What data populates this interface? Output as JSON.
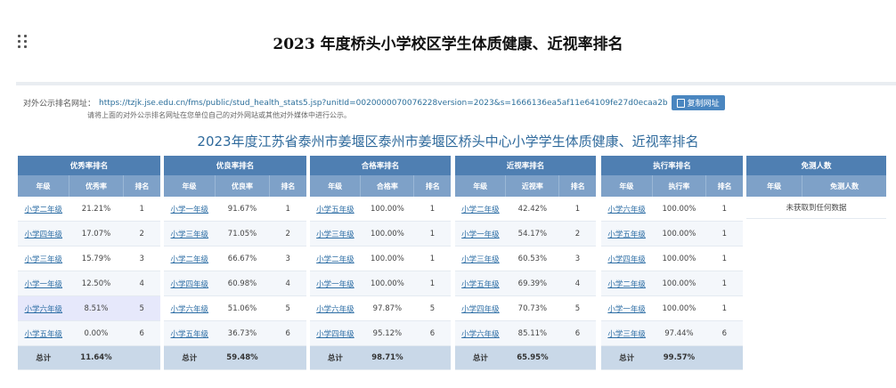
{
  "page_title": "2023 年度桥头小学校区学生体质健康、近视率排名",
  "url_row": {
    "label": "对外公示排名网址：",
    "url": "https://tzjk.jse.edu.cn/fms/public/stud_health_stats5.jsp?unitId=0020000070076228version=2023&s=1666136ea5af11e64109fe27d0ecaa2b",
    "copy_label": "复制网址"
  },
  "note": "请将上面的对外公示排名网址在您单位自己的对外网站或其他对外媒体中进行公示。",
  "report_title": "2023年度江苏省泰州市姜堰区泰州市姜堰区桥头中心小学学生体质健康、近视率排名",
  "colors": {
    "group_header": "#4f7fb2",
    "col_header": "#7ea1c8",
    "total_row": "#c9d8e8",
    "link": "#2d6ea5",
    "title": "#2f6a9c"
  },
  "tables": [
    {
      "title": "优秀率排名",
      "headers": [
        "年级",
        "优秀率",
        "排名"
      ],
      "rows": [
        [
          "小学二年级",
          "21.21%",
          "1"
        ],
        [
          "小学四年级",
          "17.07%",
          "2"
        ],
        [
          "小学三年级",
          "15.79%",
          "3"
        ],
        [
          "小学一年级",
          "12.50%",
          "4"
        ],
        [
          "小学六年级",
          "8.51%",
          "5"
        ],
        [
          "小学五年级",
          "0.00%",
          "6"
        ]
      ],
      "total": [
        "总计",
        "11.64%",
        ""
      ]
    },
    {
      "title": "优良率排名",
      "headers": [
        "年级",
        "优良率",
        "排名"
      ],
      "rows": [
        [
          "小学一年级",
          "91.67%",
          "1"
        ],
        [
          "小学三年级",
          "71.05%",
          "2"
        ],
        [
          "小学二年级",
          "66.67%",
          "3"
        ],
        [
          "小学四年级",
          "60.98%",
          "4"
        ],
        [
          "小学六年级",
          "51.06%",
          "5"
        ],
        [
          "小学五年级",
          "36.73%",
          "6"
        ]
      ],
      "total": [
        "总计",
        "59.48%",
        ""
      ]
    },
    {
      "title": "合格率排名",
      "headers": [
        "年级",
        "合格率",
        "排名"
      ],
      "rows": [
        [
          "小学五年级",
          "100.00%",
          "1"
        ],
        [
          "小学三年级",
          "100.00%",
          "1"
        ],
        [
          "小学二年级",
          "100.00%",
          "1"
        ],
        [
          "小学一年级",
          "100.00%",
          "1"
        ],
        [
          "小学六年级",
          "97.87%",
          "5"
        ],
        [
          "小学四年级",
          "95.12%",
          "6"
        ]
      ],
      "total": [
        "总计",
        "98.71%",
        ""
      ]
    },
    {
      "title": "近视率排名",
      "headers": [
        "年级",
        "近视率",
        "排名"
      ],
      "rows": [
        [
          "小学二年级",
          "42.42%",
          "1"
        ],
        [
          "小学一年级",
          "54.17%",
          "2"
        ],
        [
          "小学三年级",
          "60.53%",
          "3"
        ],
        [
          "小学五年级",
          "69.39%",
          "4"
        ],
        [
          "小学四年级",
          "70.73%",
          "5"
        ],
        [
          "小学六年级",
          "85.11%",
          "6"
        ]
      ],
      "total": [
        "总计",
        "65.95%",
        ""
      ]
    },
    {
      "title": "执行率排名",
      "headers": [
        "年级",
        "执行率",
        "排名"
      ],
      "rows": [
        [
          "小学六年级",
          "100.00%",
          "1"
        ],
        [
          "小学五年级",
          "100.00%",
          "1"
        ],
        [
          "小学四年级",
          "100.00%",
          "1"
        ],
        [
          "小学二年级",
          "100.00%",
          "1"
        ],
        [
          "小学一年级",
          "100.00%",
          "1"
        ],
        [
          "小学三年级",
          "97.44%",
          "6"
        ]
      ],
      "total": [
        "总计",
        "99.57%",
        ""
      ]
    }
  ],
  "exempt": {
    "title": "免测人数",
    "headers": [
      "年级",
      "免测人数"
    ],
    "empty_text": "未获取到任何数据"
  }
}
